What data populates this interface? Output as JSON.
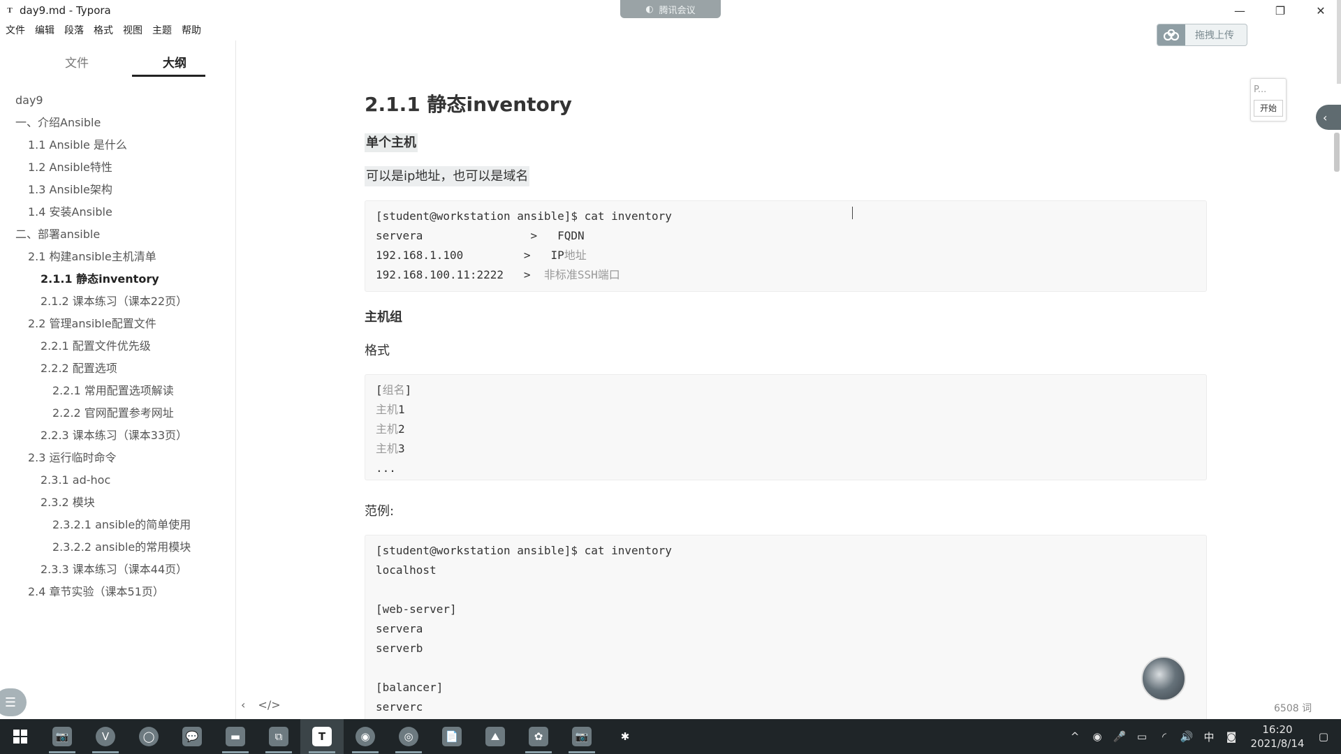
{
  "window": {
    "title": "day9.md - Typora",
    "meeting_badge": "腾讯会议",
    "controls": {
      "minimize": "—",
      "restore": "❐",
      "close": "✕"
    }
  },
  "menubar": [
    "文件",
    "编辑",
    "段落",
    "格式",
    "视图",
    "主题",
    "帮助"
  ],
  "upload": {
    "label": "拖拽上传"
  },
  "sidebar": {
    "tabs": [
      {
        "label": "文件",
        "active": false
      },
      {
        "label": "大纲",
        "active": true
      }
    ],
    "outline": [
      {
        "label": "day9",
        "level": 1,
        "active": false
      },
      {
        "label": "一、介绍Ansible",
        "level": 1,
        "active": false
      },
      {
        "label": "1.1 Ansible 是什么",
        "level": 2,
        "active": false
      },
      {
        "label": "1.2 Ansible特性",
        "level": 2,
        "active": false
      },
      {
        "label": "1.3 Ansible架构",
        "level": 2,
        "active": false
      },
      {
        "label": "1.4 安装Ansible",
        "level": 2,
        "active": false
      },
      {
        "label": "二、部署ansible",
        "level": 1,
        "active": false
      },
      {
        "label": "2.1 构建ansible主机清单",
        "level": 2,
        "active": false
      },
      {
        "label": "2.1.1 静态inventory",
        "level": 3,
        "active": true
      },
      {
        "label": "2.1.2 课本练习（课本22页）",
        "level": 3,
        "active": false
      },
      {
        "label": "2.2 管理ansible配置文件",
        "level": 2,
        "active": false
      },
      {
        "label": "2.2.1 配置文件优先级",
        "level": 3,
        "active": false
      },
      {
        "label": "2.2.2 配置选项",
        "level": 3,
        "active": false
      },
      {
        "label": "2.2.1 常用配置选项解读",
        "level": 4,
        "active": false
      },
      {
        "label": "2.2.2 官网配置参考网址",
        "level": 4,
        "active": false
      },
      {
        "label": "2.2.3 课本练习（课本33页）",
        "level": 3,
        "active": false
      },
      {
        "label": "2.3 运行临时命令",
        "level": 2,
        "active": false
      },
      {
        "label": "2.3.1 ad-hoc",
        "level": 3,
        "active": false
      },
      {
        "label": "2.3.2 模块",
        "level": 3,
        "active": false
      },
      {
        "label": "2.3.2.1 ansible的简单使用",
        "level": 4,
        "active": false
      },
      {
        "label": "2.3.2.2 ansible的常用模块",
        "level": 4,
        "active": false
      },
      {
        "label": "2.3.3 课本练习（课本44页）",
        "level": 3,
        "active": false
      },
      {
        "label": "2.4 章节实验（课本51页）",
        "level": 2,
        "active": false
      }
    ],
    "bottom": {
      "collapse": "‹",
      "source": "</>"
    }
  },
  "doc": {
    "heading": "2.1.1 静态inventory",
    "single_host_title": "单个主机",
    "single_host_desc": "可以是ip地址，也可以是域名",
    "code1": [
      {
        "text": "[student@workstation ansible]$ cat inventory",
        "comment": ""
      },
      {
        "text": "servera                >   FQDN",
        "comment": ""
      },
      {
        "text": "192.168.1.100         >   IP",
        "comment": "地址"
      },
      {
        "text": "192.168.100.11:2222   >  ",
        "comment": "非标准SSH端口"
      }
    ],
    "group_title": "主机组",
    "format_label": "格式",
    "code2": [
      {
        "text": "[",
        "comment": "组名",
        "tail": "]"
      },
      {
        "text": "",
        "comment": "主机",
        "tail": "1"
      },
      {
        "text": "",
        "comment": "主机",
        "tail": "2"
      },
      {
        "text": "",
        "comment": "主机",
        "tail": "3"
      },
      {
        "text": "...",
        "comment": "",
        "tail": ""
      }
    ],
    "example_label": "范例:",
    "code3": [
      "[student@workstation ansible]$ cat inventory",
      "localhost",
      "",
      "[web-server]",
      "servera",
      "serverb",
      "",
      "[balancer]",
      "serverc"
    ]
  },
  "widgets": {
    "top_text": "P...",
    "start": "开始"
  },
  "status": {
    "word_count": "6508 词"
  },
  "taskbar": {
    "apps": [
      "📷",
      "V",
      "◯",
      "💬",
      "▬",
      "⧉",
      "T",
      "◉",
      "◎",
      "📄",
      "⛰",
      "✿",
      "📷",
      "✱"
    ],
    "tray": {
      "chevron": "^",
      "ime": "中",
      "time": "16:20",
      "date": "2021/8/14"
    }
  }
}
